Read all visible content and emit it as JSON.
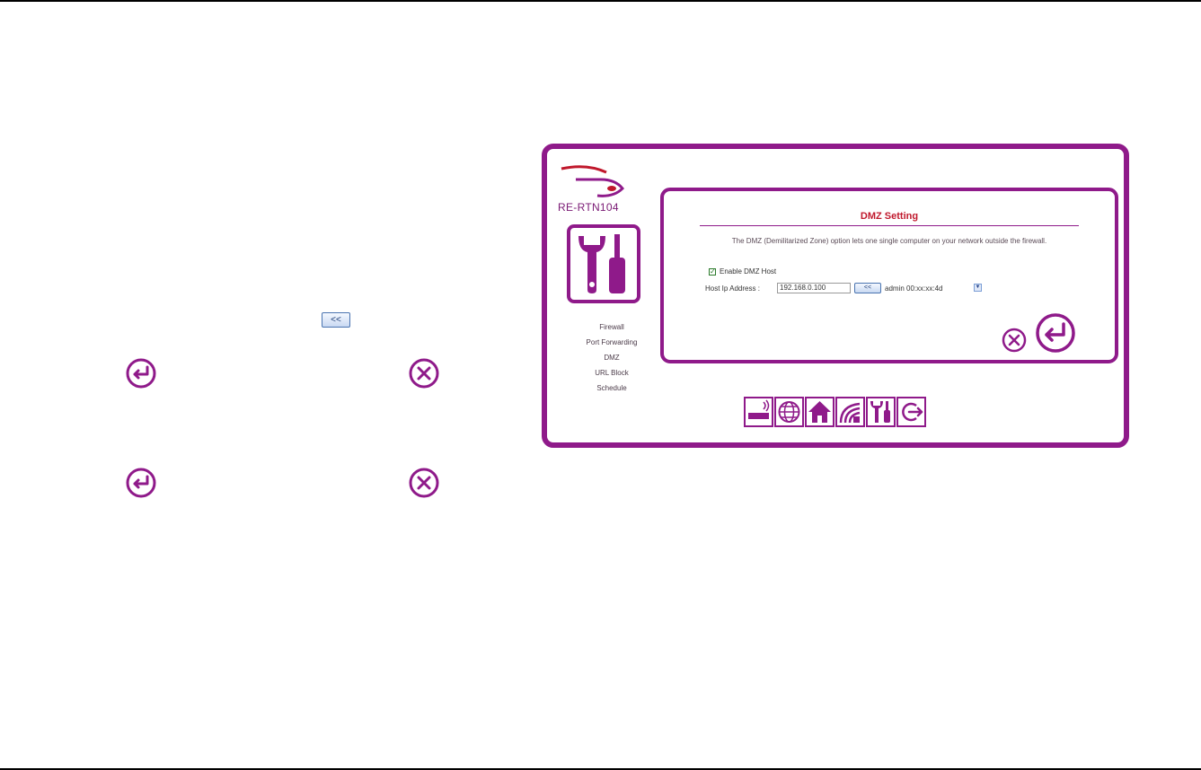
{
  "document": {
    "copy_button_label": "<<"
  },
  "device": {
    "model": "RE-RTN104"
  },
  "side_menu": {
    "items": [
      "Firewall",
      "Port Forwarding",
      "DMZ",
      "URL Block",
      "Schedule"
    ]
  },
  "dmz": {
    "title": "DMZ Setting",
    "description": "The DMZ (Demilitarized Zone) option lets one single computer on your network outside the firewall.",
    "enable_label": "Enable DMZ Host",
    "enable_checked": true,
    "host_label": "Host Ip Address :",
    "host_ip": "192.168.0.100",
    "select_button_label": "<<",
    "client_option": "admin 00:xx:xx:4d"
  },
  "icons": {
    "apply": "apply-return-icon",
    "cancel": "cancel-x-icon",
    "tools": "wrench-screwdriver-icon",
    "nav": [
      "status-icon",
      "internet-icon",
      "home-network-icon",
      "wireless-icon",
      "tools-icon",
      "logout-icon"
    ]
  },
  "colors": {
    "brand_purple": "#8f1a8a",
    "title_red": "#c0182c"
  }
}
